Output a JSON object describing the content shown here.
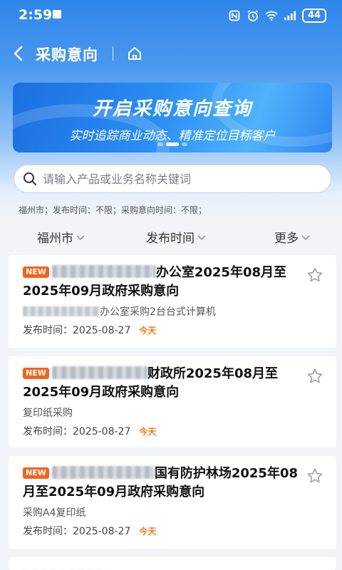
{
  "status": {
    "time": "2:59",
    "battery": "44"
  },
  "nav": {
    "title": "采购意向"
  },
  "banner": {
    "title": "开启采购意向查询",
    "subtitle": "实时追踪商业动态、精准定位目标客户"
  },
  "search": {
    "placeholder": "请输入产品或业务名称关键词"
  },
  "filter_summary": "福州市；发布时间：不限；采购意向时间：不限；",
  "filters": {
    "city": "福州市",
    "publish_time": "发布时间",
    "more": "更多"
  },
  "cards": [
    {
      "badge": "NEW",
      "title_suffix": "办公室2025年08月至2025年09月政府采购意向",
      "subtitle": "办公室采购2台台式计算机",
      "meta_label": "发布时间：",
      "date": "2025-08-27",
      "today": "今天"
    },
    {
      "badge": "NEW",
      "title_suffix": "财政所2025年08月至2025年09月政府采购意向",
      "subtitle": "复印纸采购",
      "meta_label": "发布时间：",
      "date": "2025-08-27",
      "today": "今天"
    },
    {
      "badge": "NEW",
      "title_suffix": "国有防护林场2025年08月至2025年09月政府采购意向",
      "subtitle": "采购A4复印纸",
      "meta_label": "发布时间：",
      "date": "2025-08-27",
      "today": "今天"
    }
  ]
}
